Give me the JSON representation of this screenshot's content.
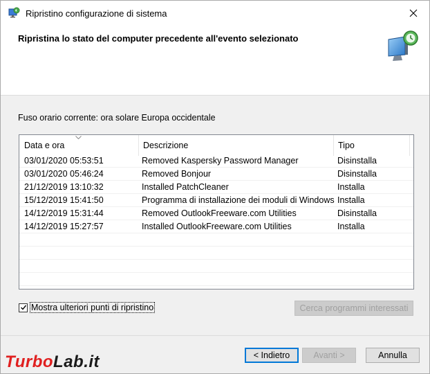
{
  "window": {
    "title": "Ripristino configurazione di sistema"
  },
  "header": {
    "title": "Ripristina lo stato del computer precedente all'evento selezionato"
  },
  "timezone_label": "Fuso orario corrente: ora solare Europa occidentale",
  "table": {
    "columns": [
      "Data e ora",
      "Descrizione",
      "Tipo"
    ],
    "rows": [
      {
        "date": "03/01/2020 05:53:51",
        "desc": "Removed Kaspersky Password Manager",
        "type": "Disinstalla"
      },
      {
        "date": "03/01/2020 05:46:24",
        "desc": "Removed Bonjour",
        "type": "Disinstalla"
      },
      {
        "date": "21/12/2019 13:10:32",
        "desc": "Installed PatchCleaner",
        "type": "Installa"
      },
      {
        "date": "15/12/2019 15:41:50",
        "desc": "Programma di installazione dei moduli di Windows",
        "type": "Installa"
      },
      {
        "date": "14/12/2019 15:31:44",
        "desc": "Removed OutlookFreeware.com Utilities",
        "type": "Disinstalla"
      },
      {
        "date": "14/12/2019 15:27:57",
        "desc": "Installed OutlookFreeware.com Utilities",
        "type": "Installa"
      }
    ]
  },
  "checkbox": {
    "label": "Mostra ulteriori punti di ripristino",
    "checked": true
  },
  "buttons": {
    "scan": "Cerca programmi interessati",
    "back": "< Indietro",
    "next": "Avanti >",
    "cancel": "Annulla"
  },
  "watermark": {
    "part1": "Turbo",
    "part2": "Lab.it"
  },
  "icons": {
    "app": "system-restore-icon",
    "header": "system-restore-large-icon",
    "close": "close-icon"
  },
  "colors": {
    "accent": "#0078d7",
    "watermark_red": "#e02020"
  }
}
